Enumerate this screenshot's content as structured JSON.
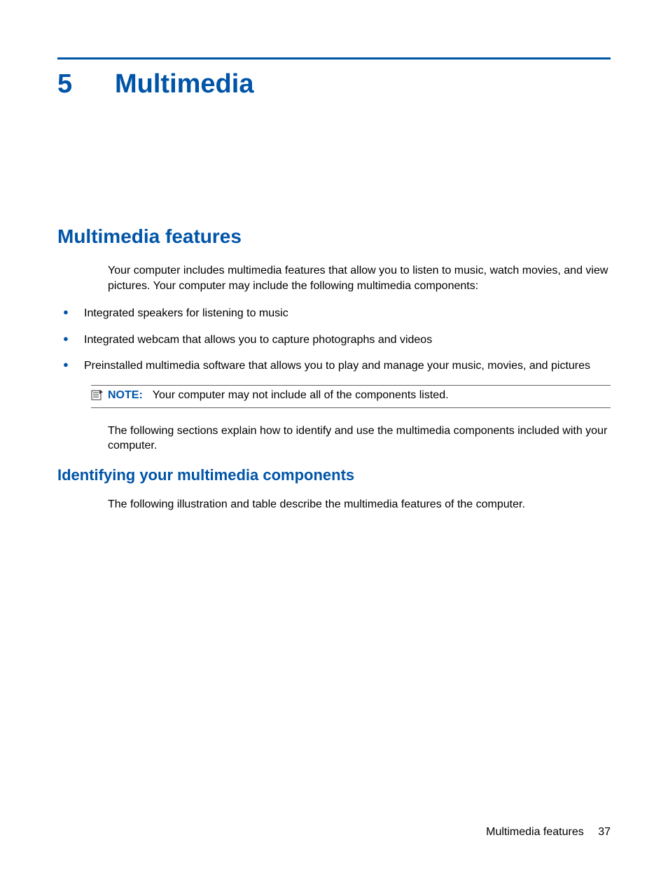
{
  "chapter": {
    "number": "5",
    "title": "Multimedia"
  },
  "section": {
    "heading": "Multimedia features",
    "intro": "Your computer includes multimedia features that allow you to listen to music, watch movies, and view pictures. Your computer may include the following multimedia components:",
    "bullets": [
      "Integrated speakers for listening to music",
      "Integrated webcam that allows you to capture photographs and videos",
      "Preinstalled multimedia software that allows you to play and manage your music, movies, and pictures"
    ],
    "note": {
      "label": "NOTE:",
      "text": "Your computer may not include all of the components listed."
    },
    "following": "The following sections explain how to identify and use the multimedia components included with your computer."
  },
  "subsection": {
    "heading": "Identifying your multimedia components",
    "text": "The following illustration and table describe the multimedia features of the computer."
  },
  "footer": {
    "section": "Multimedia features",
    "page": "37"
  }
}
